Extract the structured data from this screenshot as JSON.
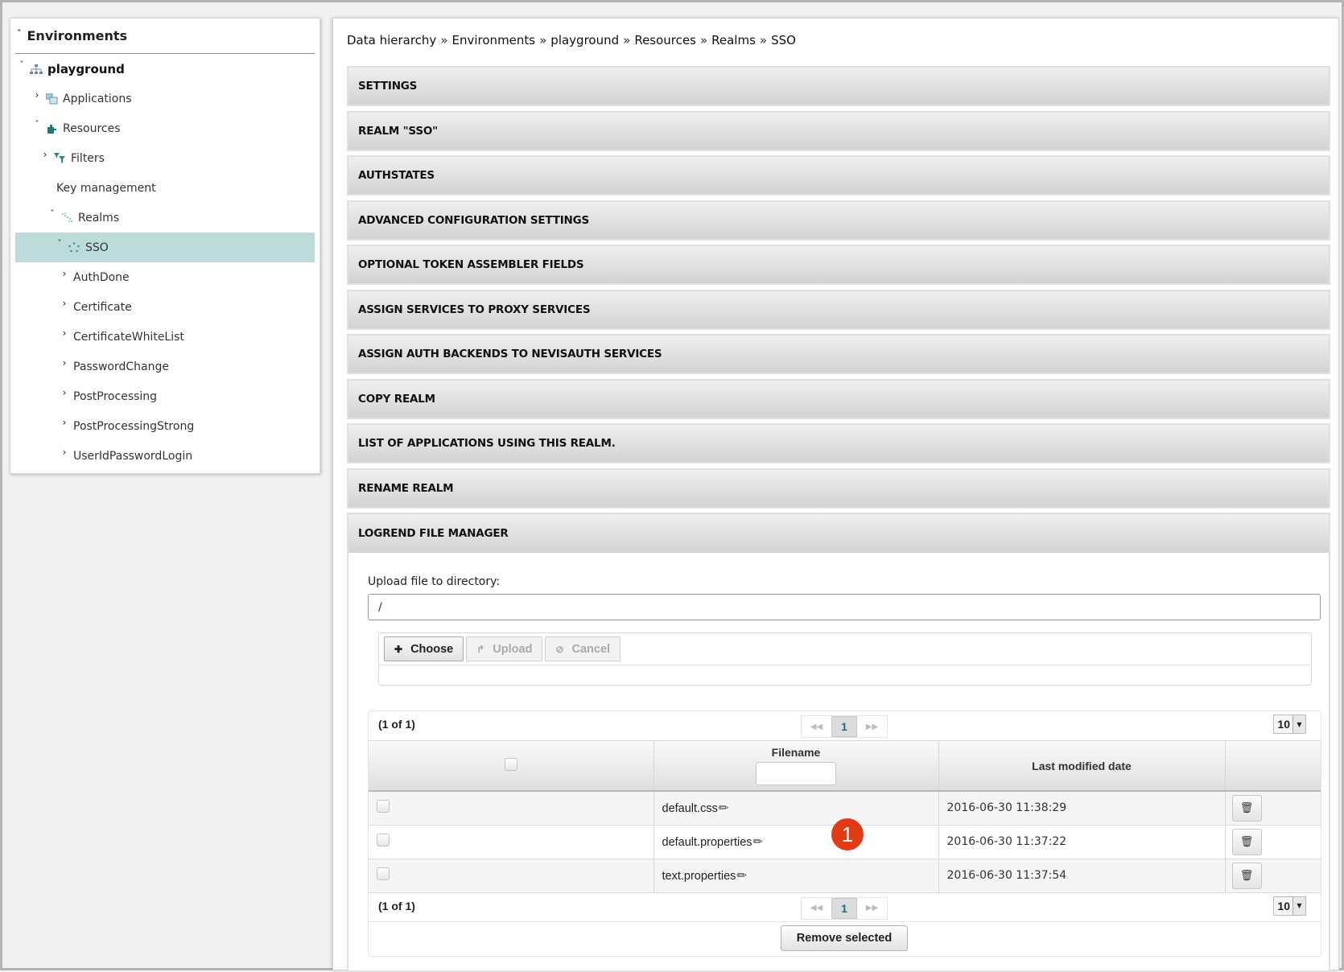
{
  "tree": {
    "header": "Environments",
    "items": [
      {
        "label": "playground",
        "state": "expanded",
        "icon": "network-icon"
      },
      {
        "label": "Applications",
        "state": "collapsed",
        "icon": "applications-icon"
      },
      {
        "label": "Resources",
        "state": "expanded",
        "icon": "puzzle-icon"
      },
      {
        "label": "Filters",
        "state": "collapsed",
        "icon": "filters-icon"
      },
      {
        "label": "Key management",
        "state": "leaf"
      },
      {
        "label": "Realms",
        "state": "expanded",
        "icon": "realms-icon"
      },
      {
        "label": "SSO",
        "state": "expanded",
        "icon": "realm-star-icon",
        "selected": true
      },
      {
        "label": "AuthDone",
        "state": "collapsed"
      },
      {
        "label": "Certificate",
        "state": "collapsed"
      },
      {
        "label": "CertificateWhiteList",
        "state": "collapsed"
      },
      {
        "label": "PasswordChange",
        "state": "collapsed"
      },
      {
        "label": "PostProcessing",
        "state": "collapsed"
      },
      {
        "label": "PostProcessingStrong",
        "state": "collapsed"
      },
      {
        "label": "UserIdPasswordLogin",
        "state": "collapsed"
      }
    ],
    "selected_color": "#bcdcdc"
  },
  "breadcrumb": {
    "separator": "»",
    "items": [
      "Data hierarchy",
      "Environments",
      "playground",
      "Resources",
      "Realms",
      "SSO"
    ]
  },
  "accordion": {
    "sections": [
      "SETTINGS",
      "REALM \"SSO\"",
      "AUTHSTATES",
      "ADVANCED CONFIGURATION SETTINGS",
      "OPTIONAL TOKEN ASSEMBLER FIELDS",
      "ASSIGN SERVICES TO PROXY SERVICES",
      "ASSIGN AUTH BACKENDS TO NEVISAUTH SERVICES",
      "COPY REALM",
      "LIST OF APPLICATIONS USING THIS REALM.",
      "RENAME REALM",
      "LOGREND FILE MANAGER"
    ],
    "open_section": "LOGREND FILE MANAGER"
  },
  "file_manager": {
    "upload_label": "Upload file to directory:",
    "directory_value": "/",
    "buttons": {
      "choose": "Choose",
      "upload": "Upload",
      "cancel": "Cancel"
    },
    "paginator": {
      "count_text": "(1 of 1)",
      "current_page": "1",
      "first_glyph": "<<",
      "last_glyph": ">>",
      "rows_per_page": "10"
    },
    "columns": {
      "filename": "Filename",
      "last_modified": "Last modified date"
    },
    "files": [
      {
        "name": "default.css",
        "modified": "2016-06-30 11:38:29"
      },
      {
        "name": "default.properties",
        "modified": "2016-06-30 11:37:22"
      },
      {
        "name": "text.properties",
        "modified": "2016-06-30 11:37:54"
      }
    ],
    "remove_selected": "Remove selected"
  },
  "callout_badge": "1",
  "colors": {
    "badge": "#e23a12",
    "current_page_text": "#1b6e86"
  }
}
